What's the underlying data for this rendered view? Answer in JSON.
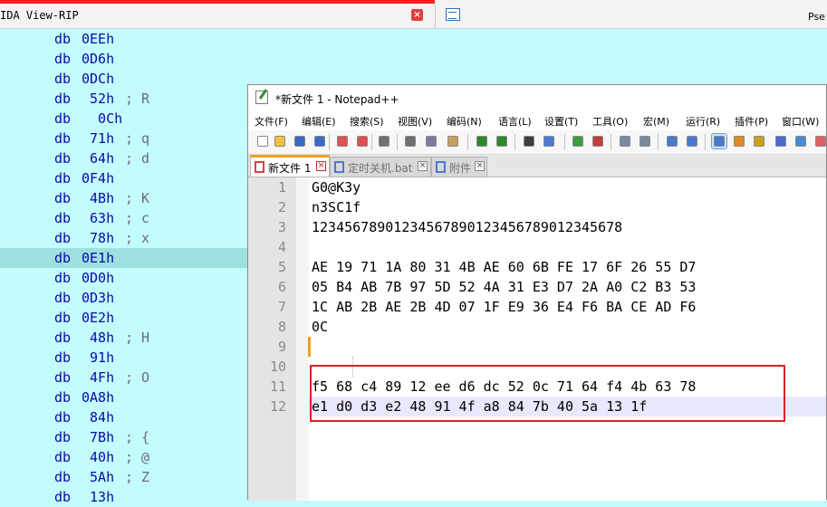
{
  "ida": {
    "title": "IDA View-RIP",
    "close_glyph": "×",
    "pseudo_tab_title": "Pse",
    "keyword": "db",
    "lines": [
      {
        "value": "0EEh",
        "comment": ""
      },
      {
        "value": "0D6h",
        "comment": ""
      },
      {
        "value": "0DCh",
        "comment": ""
      },
      {
        "value": " 52h",
        "comment": "; R"
      },
      {
        "value": "  0Ch",
        "comment": ""
      },
      {
        "value": " 71h",
        "comment": "; q"
      },
      {
        "value": " 64h",
        "comment": "; d"
      },
      {
        "value": "0F4h",
        "comment": ""
      },
      {
        "value": " 4Bh",
        "comment": "; K"
      },
      {
        "value": " 63h",
        "comment": "; c"
      },
      {
        "value": " 78h",
        "comment": "; x"
      },
      {
        "value": "0E1h",
        "comment": "",
        "selected": true
      },
      {
        "value": "0D0h",
        "comment": ""
      },
      {
        "value": "0D3h",
        "comment": ""
      },
      {
        "value": "0E2h",
        "comment": ""
      },
      {
        "value": " 48h",
        "comment": "; H"
      },
      {
        "value": " 91h",
        "comment": ""
      },
      {
        "value": " 4Fh",
        "comment": "; O"
      },
      {
        "value": "0A8h",
        "comment": ""
      },
      {
        "value": " 84h",
        "comment": ""
      },
      {
        "value": " 7Bh",
        "comment": "; {"
      },
      {
        "value": " 40h",
        "comment": "; @"
      },
      {
        "value": " 5Ah",
        "comment": "; Z"
      },
      {
        "value": " 13h",
        "comment": ""
      }
    ]
  },
  "notepad": {
    "title": "*新文件 1 - Notepad++",
    "menu": [
      "文件(F)",
      "编辑(E)",
      "搜索(S)",
      "视图(V)",
      "编码(N)",
      "语言(L)",
      "设置(T)",
      "工具(O)",
      "宏(M)",
      "运行(R)",
      "插件(P)",
      "窗口(W)"
    ],
    "toolbar_icons": [
      "new-file-icon",
      "open-file-icon",
      "save-icon",
      "save-all-icon",
      "close-icon",
      "close-all-icon",
      "print-icon",
      "cut-icon",
      "copy-icon",
      "paste-icon",
      "undo-icon",
      "redo-icon",
      "find-icon",
      "replace-icon",
      "zoom-in-icon",
      "zoom-out-icon",
      "sync-v-icon",
      "sync-h-icon",
      "word-wrap-icon",
      "show-all-chars-icon",
      "indent-guide-icon",
      "udl-icon",
      "doc-map-icon",
      "function-list-icon",
      "folder-workspace-icon",
      "monitor-icon"
    ],
    "tabs": [
      {
        "label": "新文件 1",
        "active": true,
        "icon_color": "#e04040"
      },
      {
        "label": "定时关机.bat",
        "active": false,
        "icon_color": "#4a7ad0"
      },
      {
        "label": "附件",
        "active": false,
        "icon_color": "#4a7ad0"
      }
    ],
    "tab_close_glyph": "×",
    "lines": [
      {
        "n": "1",
        "text": "G0@K3y"
      },
      {
        "n": "2",
        "text": "n3SC1f"
      },
      {
        "n": "3",
        "text": "12345678901234567890123456789012345678"
      },
      {
        "n": "4",
        "text": ""
      },
      {
        "n": "5",
        "text": "AE 19 71 1A 80 31 4B AE 60 6B FE 17 6F 26 55 D7"
      },
      {
        "n": "6",
        "text": "05 B4 AB 7B 97 5D 52 4A 31 E3 D7 2A A0 C2 B3 53"
      },
      {
        "n": "7",
        "text": "1C AB 2B AE 2B 4D 07 1F E9 36 E4 F6 BA CE AD F6"
      },
      {
        "n": "8",
        "text": "0C"
      },
      {
        "n": "9",
        "text": ""
      },
      {
        "n": "10",
        "text": ""
      },
      {
        "n": "11",
        "text": "f5 68 c4 89 12 ee d6 dc 52 0c 71 64 f4 4b 63 78"
      },
      {
        "n": "12",
        "text": "e1 d0 d3 e2 48 91 4f a8 84 7b 40 5a 13 1f"
      }
    ]
  },
  "colors": {
    "ida_background": "#c2fcfc",
    "ida_text": "#0a0aa8",
    "highlight_box": "#e02020",
    "active_tab_accent": "#f0a020"
  }
}
